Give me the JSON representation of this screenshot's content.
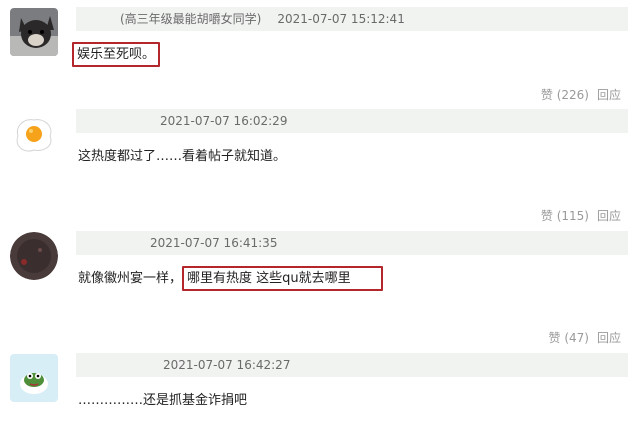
{
  "comments": [
    {
      "nickname": "(高三年级最能胡嚼女同学)",
      "time": "2021-07-07 15:12:41",
      "text_plain": "",
      "text_highlight": "娱乐至死呗。",
      "avatar_icon": "dog-photo-avatar",
      "like_label": "赞 (226)",
      "reply_label": "回应"
    },
    {
      "nickname": "",
      "time": "2021-07-07 16:02:29",
      "text_plain": "这热度都过了……看着帖子就知道。",
      "text_highlight": "",
      "avatar_icon": "fried-egg-avatar",
      "like_label": "赞 (115)",
      "reply_label": "回应"
    },
    {
      "nickname": "",
      "time": "2021-07-07 16:41:35",
      "text_plain": "就像徽州宴一样，",
      "text_highlight": "哪里有热度 这些qu就去哪里",
      "avatar_icon": "dark-circle-avatar",
      "like_label": "赞 (47)",
      "reply_label": "回应"
    },
    {
      "nickname": "",
      "time": "2021-07-07 16:42:27",
      "text_plain": "……………还是抓基金诈捐吧",
      "text_highlight": "",
      "avatar_icon": "frog-avatar",
      "like_label": "",
      "reply_label": ""
    }
  ],
  "colors": {
    "highlight_border": "#b3262b",
    "meta_background": "#f1f3f1",
    "action_text": "#9a9a9a"
  }
}
